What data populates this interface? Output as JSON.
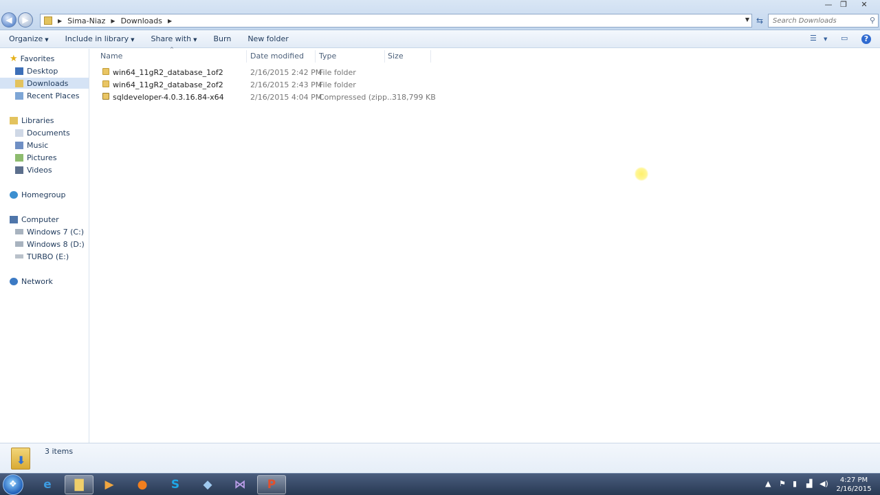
{
  "window": {
    "minimize": "—",
    "maximize": "❐",
    "close": "✕"
  },
  "address": {
    "crumbs": [
      "Sima-Niaz",
      "Downloads"
    ],
    "search_placeholder": "Search Downloads"
  },
  "toolbar": {
    "organize": "Organize",
    "include_in_library": "Include in library",
    "share_with": "Share with",
    "burn": "Burn",
    "new_folder": "New folder"
  },
  "navigation": {
    "favorites": "Favorites",
    "desktop": "Desktop",
    "downloads": "Downloads",
    "recent_places": "Recent Places",
    "libraries": "Libraries",
    "documents": "Documents",
    "music": "Music",
    "pictures": "Pictures",
    "videos": "Videos",
    "homegroup": "Homegroup",
    "computer": "Computer",
    "drive_c": "Windows 7 (C:)",
    "drive_d": "Windows 8 (D:)",
    "drive_e": "TURBO (E:)",
    "network": "Network"
  },
  "columns": {
    "name": "Name",
    "date_modified": "Date modified",
    "type": "Type",
    "size": "Size"
  },
  "files": [
    {
      "name": "win64_11gR2_database_1of2",
      "date": "2/16/2015 2:42 PM",
      "type": "File folder",
      "size": ""
    },
    {
      "name": "win64_11gR2_database_2of2",
      "date": "2/16/2015 2:43 PM",
      "type": "File folder",
      "size": ""
    },
    {
      "name": "sqldeveloper-4.0.3.16.84-x64",
      "date": "2/16/2015 4:04 PM",
      "type": "Compressed (zipp...",
      "size": "318,799 KB"
    }
  ],
  "status": {
    "items": "3 items"
  },
  "clock": {
    "time": "4:27 PM",
    "date": "2/16/2015"
  },
  "colors": {
    "accent": "#1e395b",
    "selection": "#d5e3f5"
  }
}
